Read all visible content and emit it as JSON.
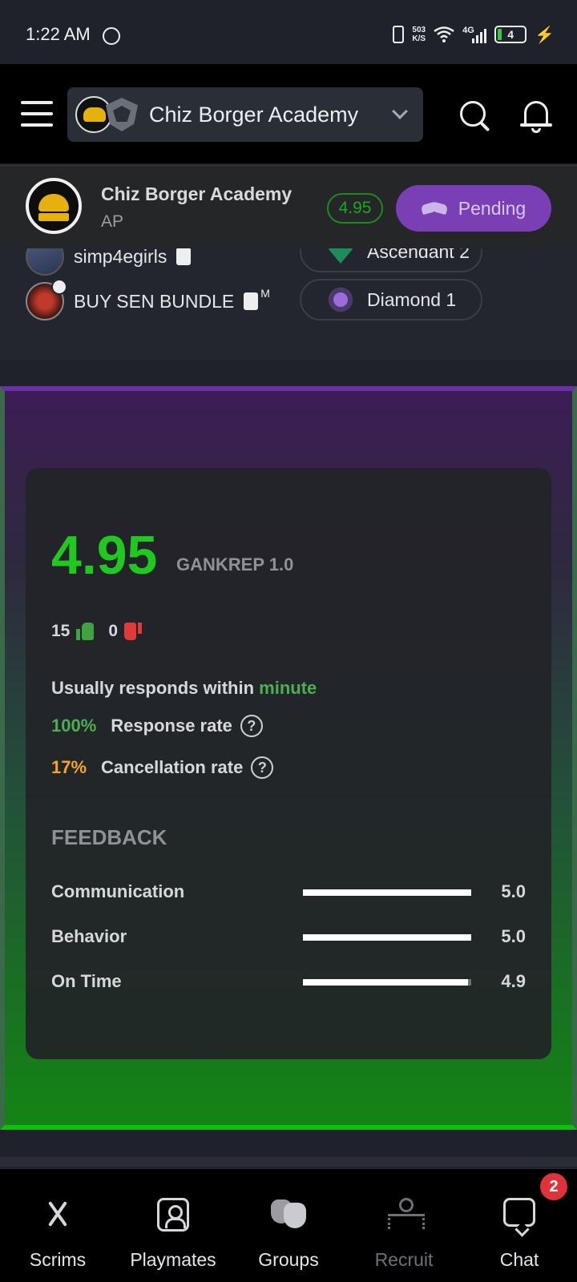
{
  "status_bar": {
    "time": "1:22 AM",
    "net_speed": "503",
    "net_unit": "K/S",
    "network": "4G",
    "battery": "4"
  },
  "header": {
    "team_selector": "Chiz Borger Academy"
  },
  "team_header": {
    "name": "Chiz Borger Academy",
    "region": "AP",
    "score": "4.95",
    "action_label": "Pending"
  },
  "roster": [
    {
      "name": "simp4egirls",
      "role_tag": "",
      "rank": "Ascendant 2"
    },
    {
      "name": "BUY SEN BUNDLE",
      "role_tag": "M",
      "rank": "Diamond 1"
    }
  ],
  "reputation": {
    "score": "4.95",
    "system": "GANKREP 1.0",
    "likes": "15",
    "dislikes": "0",
    "response_prefix": "Usually responds within",
    "response_time": "minute",
    "response_rate": "100%",
    "response_rate_label": "Response rate",
    "cancellation_rate": "17%",
    "cancellation_rate_label": "Cancellation rate",
    "help_glyph": "?",
    "feedback_title": "FEEDBACK",
    "feedback": [
      {
        "label": "Communication",
        "value": "5.0",
        "fraction": 1.0
      },
      {
        "label": "Behavior",
        "value": "5.0",
        "fraction": 1.0
      },
      {
        "label": "On Time",
        "value": "4.9",
        "fraction": 0.98
      }
    ],
    "colors": {
      "score": "#1fc91f",
      "positive": "#4caf50",
      "warning": "#f5a623",
      "negative": "#e03a3a"
    }
  },
  "bottom_nav": {
    "items": [
      {
        "label": "Scrims",
        "icon": "crossed-swords-icon"
      },
      {
        "label": "Playmates",
        "icon": "user-card-icon"
      },
      {
        "label": "Groups",
        "icon": "masks-icon"
      },
      {
        "label": "Recruit",
        "icon": "org-chart-icon"
      },
      {
        "label": "Chat",
        "icon": "chat-bubble-icon"
      }
    ],
    "chat_badge": "2"
  }
}
